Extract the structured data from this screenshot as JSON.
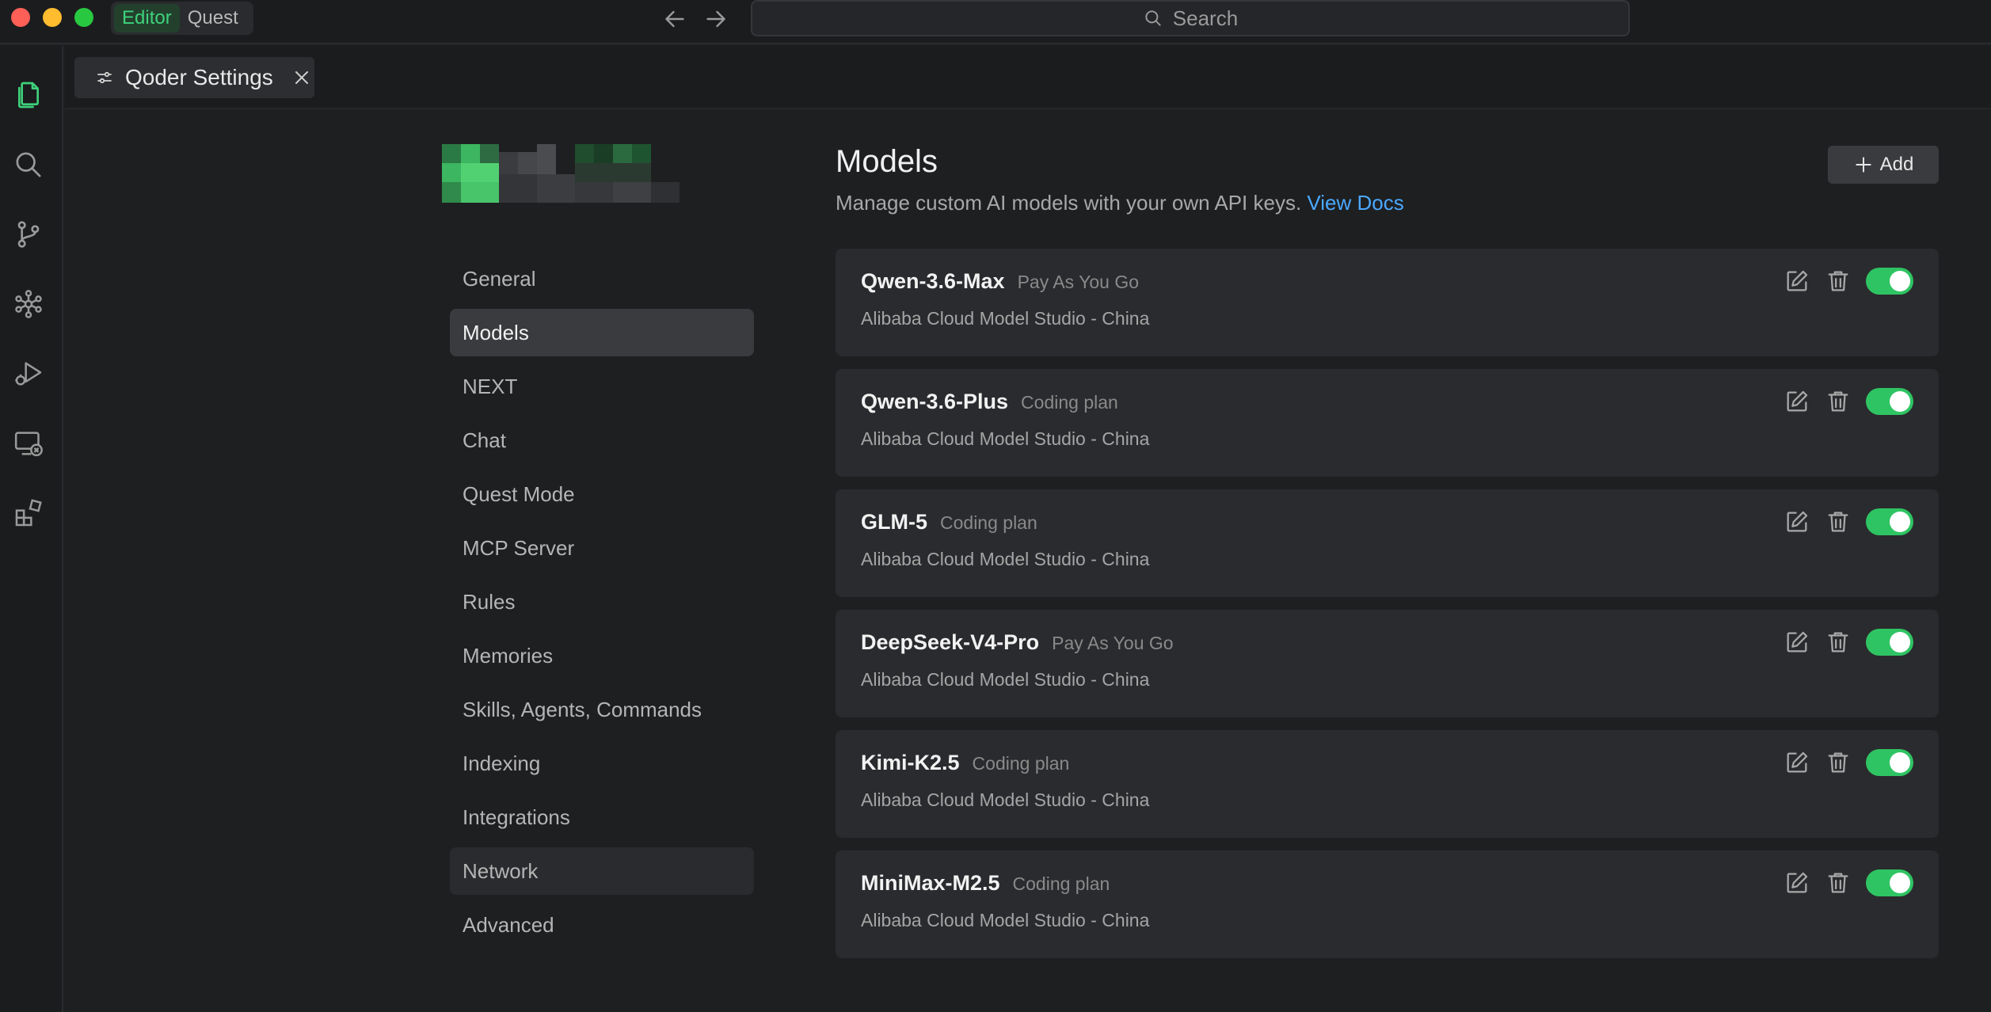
{
  "titlebar": {
    "modes": [
      {
        "label": "Editor",
        "active": true
      },
      {
        "label": "Quest",
        "active": false
      }
    ],
    "search_label": "Search"
  },
  "activity_bar": {
    "icons": [
      "files-icon",
      "search-icon",
      "source-control-icon",
      "network-icon",
      "run-debug-icon",
      "remote-icon",
      "extensions-icon"
    ]
  },
  "tab": {
    "title": "Qoder Settings"
  },
  "settings_nav": {
    "items": [
      {
        "label": "General"
      },
      {
        "label": "Models",
        "active": true
      },
      {
        "label": "NEXT"
      },
      {
        "label": "Chat"
      },
      {
        "label": "Quest Mode"
      },
      {
        "label": "MCP Server"
      },
      {
        "label": "Rules"
      },
      {
        "label": "Memories"
      },
      {
        "label": "Skills, Agents, Commands"
      },
      {
        "label": "Indexing"
      },
      {
        "label": "Integrations"
      },
      {
        "label": "Network",
        "hover": true
      },
      {
        "label": "Advanced"
      }
    ]
  },
  "page": {
    "title": "Models",
    "description": "Manage custom AI models with your own API keys.",
    "docs_link": "View Docs",
    "add_label": "Add"
  },
  "models": [
    {
      "name": "Qwen-3.6-Max",
      "plan": "Pay As You Go",
      "provider": "Alibaba Cloud Model Studio - China",
      "enabled": true
    },
    {
      "name": "Qwen-3.6-Plus",
      "plan": "Coding plan",
      "provider": "Alibaba Cloud Model Studio - China",
      "enabled": true
    },
    {
      "name": "GLM-5",
      "plan": "Coding plan",
      "provider": "Alibaba Cloud Model Studio - China",
      "enabled": true
    },
    {
      "name": "DeepSeek-V4-Pro",
      "plan": "Pay As You Go",
      "provider": "Alibaba Cloud Model Studio - China",
      "enabled": true
    },
    {
      "name": "Kimi-K2.5",
      "plan": "Coding plan",
      "provider": "Alibaba Cloud Model Studio - China",
      "enabled": true
    },
    {
      "name": "MiniMax-M2.5",
      "plan": "Coding plan",
      "provider": "Alibaba Cloud Model Studio - China",
      "enabled": true
    }
  ],
  "colors": {
    "accent_green": "#3ed17b",
    "toggle_on": "#2fc463",
    "link_blue": "#4aa8ff",
    "background": "#1e1f21",
    "card": "#2a2b2e"
  }
}
